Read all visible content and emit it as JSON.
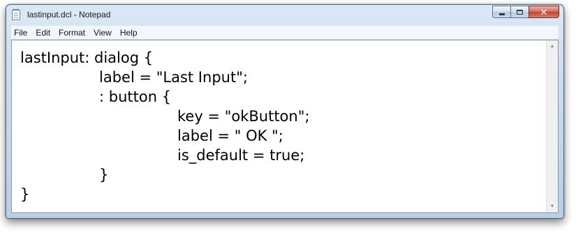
{
  "window": {
    "title": "lastinput.dcl - Notepad",
    "controls": {
      "minimize_icon": "minimize-icon",
      "maximize_icon": "maximize-icon",
      "close_icon": "close-icon",
      "close_glyph": "✕"
    }
  },
  "menu": {
    "items": [
      "File",
      "Edit",
      "Format",
      "View",
      "Help"
    ]
  },
  "editor": {
    "lines": [
      "lastInput: dialog {",
      "label = \"Last Input\";",
      ": button {",
      "key = \"okButton\";",
      "label = \" OK \";",
      "is_default = true;",
      "}",
      "}"
    ]
  },
  "scrollbar": {
    "up_glyph": "▲",
    "down_glyph": "▼"
  },
  "colors": {
    "titlebar": "#c9dcf0",
    "close_button": "#c3432e",
    "editor_background": "#ffffff"
  }
}
